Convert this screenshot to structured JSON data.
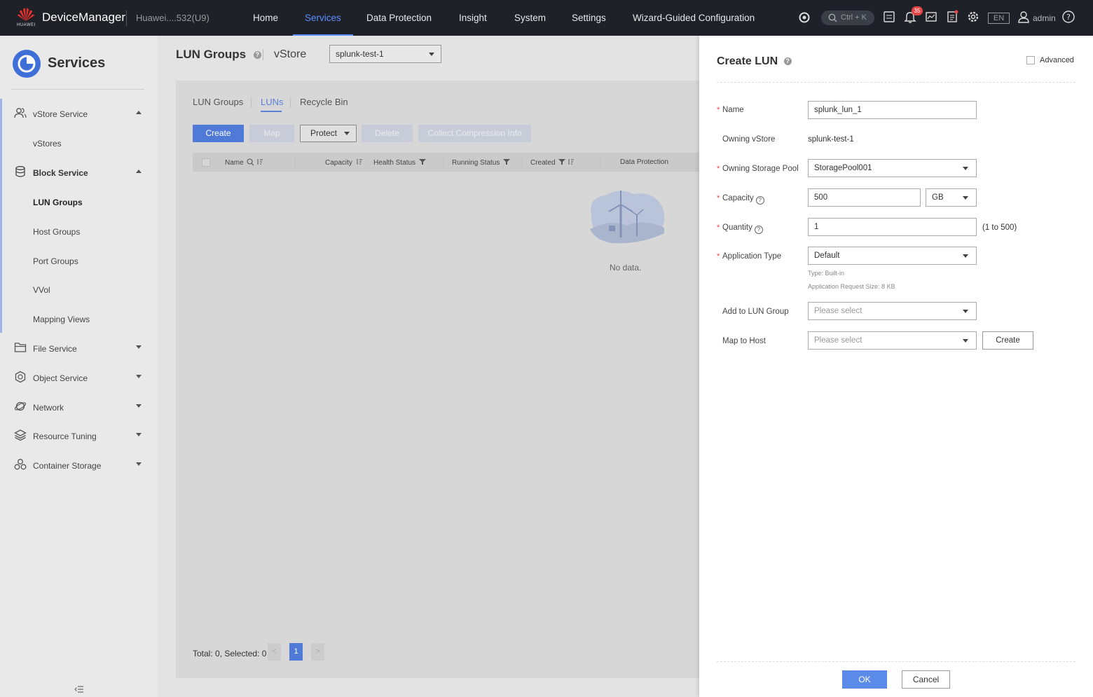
{
  "topbar": {
    "logo_text": "HUAWEI",
    "app_name": "DeviceManager",
    "device_name": "Huawei....532(U9)",
    "nav": [
      {
        "label": "Home",
        "active": false
      },
      {
        "label": "Services",
        "active": true
      },
      {
        "label": "Data Protection",
        "active": false
      },
      {
        "label": "Insight",
        "active": false
      },
      {
        "label": "System",
        "active": false
      },
      {
        "label": "Settings",
        "active": false
      },
      {
        "label": "Wizard-Guided Configuration",
        "active": false
      }
    ],
    "search_shortcut": "Ctrl + K",
    "alarm_count": "35",
    "language": "EN",
    "user": "admin"
  },
  "sidebar": {
    "title": "Services",
    "items": [
      {
        "label": "vStore Service",
        "icon": "people-icon",
        "expanded": true
      },
      {
        "label": "vStores"
      },
      {
        "label": "Block Service",
        "icon": "cylinder-icon",
        "expanded": true
      },
      {
        "label": "LUN Groups",
        "active": true
      },
      {
        "label": "Host Groups"
      },
      {
        "label": "Port Groups"
      },
      {
        "label": "VVol"
      },
      {
        "label": "Mapping Views"
      },
      {
        "label": "File Service",
        "icon": "folder-icon",
        "expanded": false
      },
      {
        "label": "Object Service",
        "icon": "hexagon-icon",
        "expanded": false
      },
      {
        "label": "Network",
        "icon": "planet-icon",
        "expanded": false
      },
      {
        "label": "Resource Tuning",
        "icon": "layers-icon",
        "expanded": false
      },
      {
        "label": "Container Storage",
        "icon": "container-icon",
        "expanded": false
      }
    ],
    "collapse_icon": "collapse-icon"
  },
  "main": {
    "page_title": "LUN Groups",
    "vstore_label": "vStore",
    "vstore_value": "splunk-test-1",
    "tabs": [
      {
        "label": "LUN Groups",
        "active": false
      },
      {
        "label": "LUNs",
        "active": true
      },
      {
        "label": "Recycle Bin",
        "active": false
      }
    ],
    "buttons": {
      "create": "Create",
      "map": "Map",
      "protect": "Protect",
      "delete": "Delete",
      "collect": "Collect Compression Info"
    },
    "columns": [
      "Name",
      "Capacity",
      "Health Status",
      "Running Status",
      "Created",
      "Data Protection"
    ],
    "empty_text": "No data.",
    "pager": {
      "summary": "Total: 0, Selected: 0",
      "current_page": "1"
    }
  },
  "drawer": {
    "title": "Create LUN",
    "advanced_label": "Advanced",
    "fields": {
      "name": {
        "label": "Name",
        "value": "splunk_lun_1"
      },
      "owning_vstore": {
        "label": "Owning vStore",
        "value": "splunk-test-1"
      },
      "storage_pool": {
        "label": "Owning Storage Pool",
        "value": "StoragePool001"
      },
      "capacity": {
        "label": "Capacity",
        "value": "500",
        "unit": "GB"
      },
      "quantity": {
        "label": "Quantity",
        "value": "1",
        "range": "(1 to 500)"
      },
      "app_type": {
        "label": "Application Type",
        "value": "Default",
        "hint1": "Type: Built-in",
        "hint2": "Application Request Size: 8 KB"
      },
      "lun_group": {
        "label": "Add to LUN Group",
        "placeholder": "Please select"
      },
      "map_host": {
        "label": "Map to Host",
        "placeholder": "Please select",
        "create_label": "Create"
      }
    },
    "ok_label": "OK",
    "cancel_label": "Cancel"
  },
  "colors": {
    "accent": "#4f7ad8",
    "topbar": "#1e2128",
    "required": "#e64545"
  }
}
